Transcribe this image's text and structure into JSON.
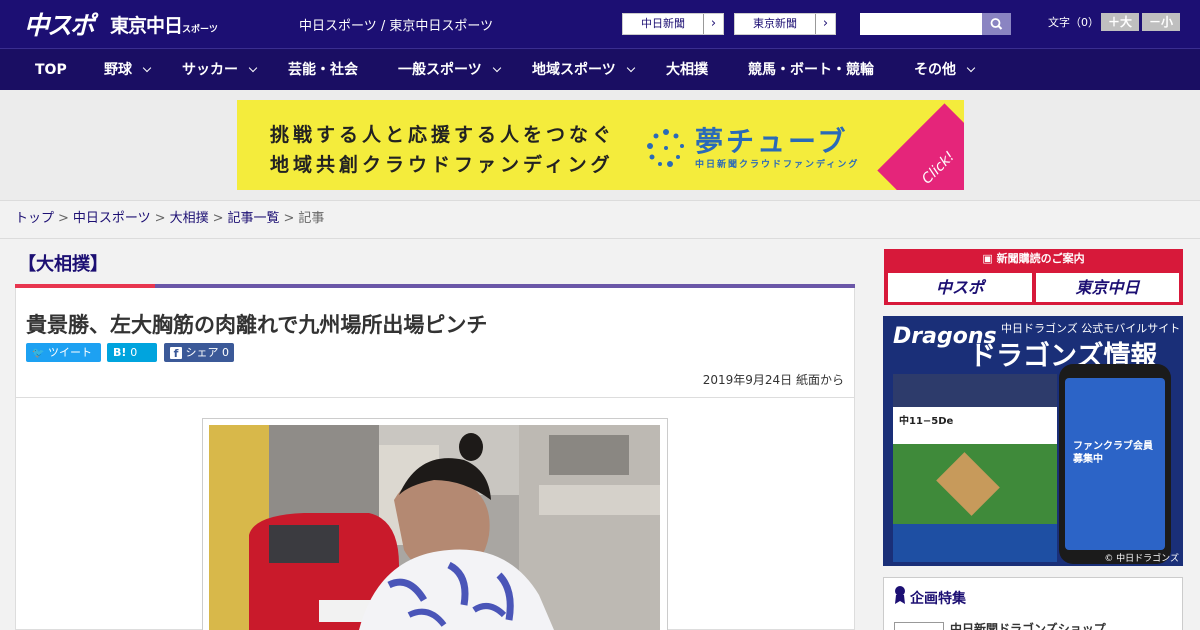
{
  "header": {
    "logo_chuspo": "中スポ",
    "logo_tokyo": "東京中日",
    "logo_tokyo_small": "スポーツ",
    "site_title": "中日スポーツ / 東京中日スポーツ",
    "link_chunichi": "中日新聞",
    "link_tokyo": "東京新聞",
    "search_placeholder": "",
    "font_label": "文字（0）",
    "font_large": "＋大",
    "font_small": "－小"
  },
  "nav": {
    "items": [
      "TOP",
      "野球",
      "サッカー",
      "芸能・社会",
      "一般スポーツ",
      "地域スポーツ",
      "大相撲",
      "競馬・ボート・競輪",
      "その他"
    ]
  },
  "banner": {
    "line1": "挑戦する人と応援する人をつなぐ",
    "line2": "地域共創クラウドファンディング",
    "logo": "夢チューブ",
    "sub": "中日新聞クラウドファンディング",
    "click": "Click!"
  },
  "breadcrumb": {
    "items": [
      "トップ",
      "中日スポーツ",
      "大相撲",
      "記事一覧"
    ],
    "current": "記事"
  },
  "article": {
    "category": "【大相撲】",
    "headline": "貴景勝、左大胸筋の肉離れで九州場所出場ピンチ",
    "tweet_label": "ツイート",
    "hatena_label": "B!",
    "hatena_count": "0",
    "share_label": "シェア",
    "share_count": "0",
    "date": "2019年9月24日 紙面から"
  },
  "sidebar": {
    "subscribe_title": "新聞購読のご案内",
    "subscribe_chuspo": "中スポ",
    "subscribe_tokyo": "東京中日",
    "dragons_logo": "Dragons",
    "dragons_tag": "中日ドラゴンズ 公式モバイルサイト",
    "dragons_title": "ドラゴンズ情報",
    "dragons_score": "中11−5De",
    "dragons_member": "ファンクラブ会員募集中",
    "dragons_copy": "© 中日ドラゴンズ",
    "feature_title": "企画特集",
    "feature_item": "中日新聞ドラゴンズショップ"
  },
  "colors": {
    "header_bg": "#1c0f73",
    "nav_bg": "#1a0e63",
    "accent_red": "#e8364f",
    "accent_purple": "#6b57a8",
    "banner_yellow": "#f4ec3c",
    "twitter": "#1da1f2",
    "hatena": "#00a4de",
    "facebook": "#3b5998"
  },
  "icons": [
    "search-icon",
    "chevron-right-icon",
    "chevron-down-icon",
    "twitter-icon",
    "hatena-icon",
    "facebook-icon",
    "newspaper-icon",
    "ribbon-icon"
  ]
}
